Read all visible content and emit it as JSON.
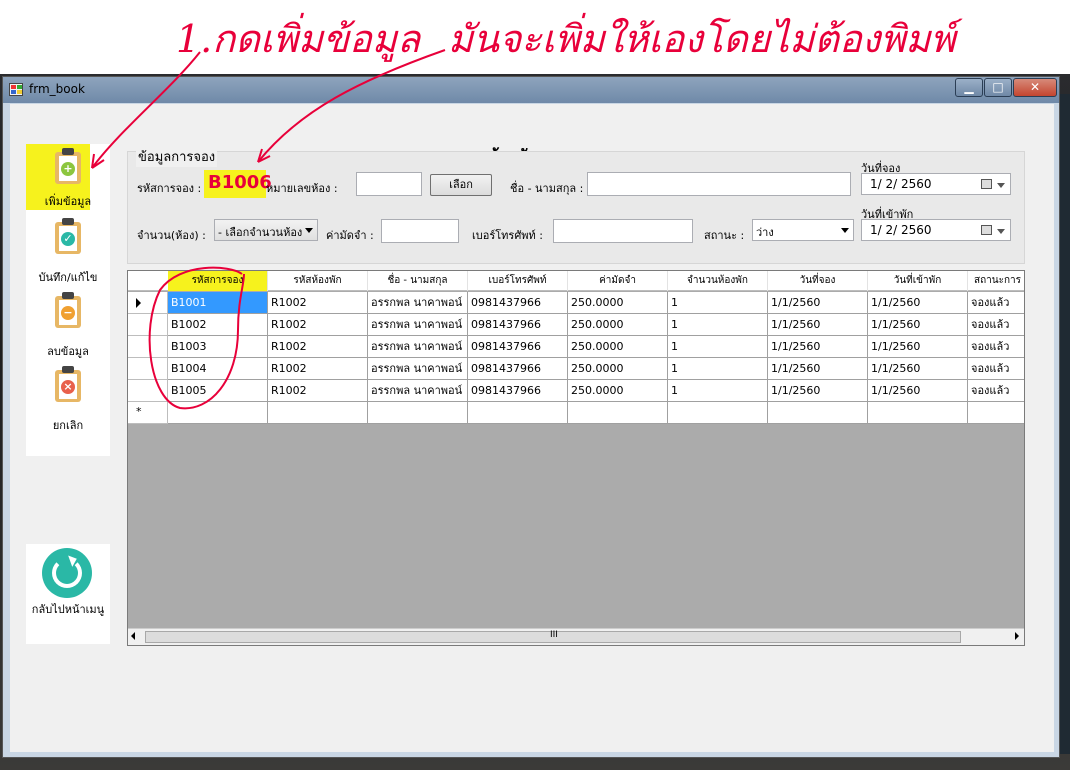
{
  "window": {
    "title": "frm_book"
  },
  "annotation": {
    "line1": "1.กดเพิ่มข้อมูล",
    "line2": "มันจะเพิ่มให้เองโดยไม่ต้องพิมพ์",
    "booking_code": "B1006"
  },
  "page_title": "จองห้องพัก",
  "sidebar": {
    "add": "เพิ่มข้อมูล",
    "save": "บันทึก/แก้ไข",
    "delete": "ลบข้อมูล",
    "cancel": "ยกเลิก",
    "back": "กลับไปหน้าเมนู"
  },
  "form": {
    "group_title": "ข้อมูลการจอง",
    "booking_code_label": "รหัสการจอง :",
    "room_no_label": "หมายเลขห้อง :",
    "room_no_value": "",
    "choose_button": "เลือก",
    "name_label": "ชื่อ - นามสกุล :",
    "name_value": "",
    "booking_date_label": "วันที่จอง",
    "booking_date_value": "1/ 2/ 2560",
    "rooms_label": "จำนวน(ห้อง) :",
    "rooms_select": "- เลือกจำนวนห้อง",
    "deposit_label": "ค่ามัดจำ :",
    "deposit_value": "",
    "phone_label": "เบอร์โทรศัพท์ :",
    "phone_value": "",
    "status_label": "สถานะ :",
    "status_select": "ว่าง",
    "checkin_label": "วันที่เข้าพัก",
    "checkin_value": "1/ 2/ 2560"
  },
  "grid": {
    "columns": [
      "รหัสการจอง",
      "รหัสห้องพัก",
      "ชื่อ - นามสกุล",
      "เบอร์โทรศัพท์",
      "ค่ามัดจำ",
      "จำนวนห้องพัก",
      "วันที่จอง",
      "วันที่เข้าพัก",
      "สถานะการ"
    ],
    "rows": [
      [
        "B1001",
        "R1002",
        "อรรกพล นาคาพอน์",
        "0981437966",
        "250.0000",
        "1",
        "1/1/2560",
        "1/1/2560",
        "จองแล้ว"
      ],
      [
        "B1002",
        "R1002",
        "อรรกพล นาคาพอน์",
        "0981437966",
        "250.0000",
        "1",
        "1/1/2560",
        "1/1/2560",
        "จองแล้ว"
      ],
      [
        "B1003",
        "R1002",
        "อรรกพล นาคาพอน์",
        "0981437966",
        "250.0000",
        "1",
        "1/1/2560",
        "1/1/2560",
        "จองแล้ว"
      ],
      [
        "B1004",
        "R1002",
        "อรรกพล นาคาพอน์",
        "0981437966",
        "250.0000",
        "1",
        "1/1/2560",
        "1/1/2560",
        "จองแล้ว"
      ],
      [
        "B1005",
        "R1002",
        "อรรกพล นาคาพอน์",
        "0981437966",
        "250.0000",
        "1",
        "1/1/2560",
        "1/1/2560",
        "จองแล้ว"
      ]
    ],
    "scroll_label": "III",
    "new_row_marker": "*"
  },
  "colors": {
    "accent_red": "#e8003a",
    "highlight": "#f6f21d",
    "selection": "#3399ff"
  }
}
